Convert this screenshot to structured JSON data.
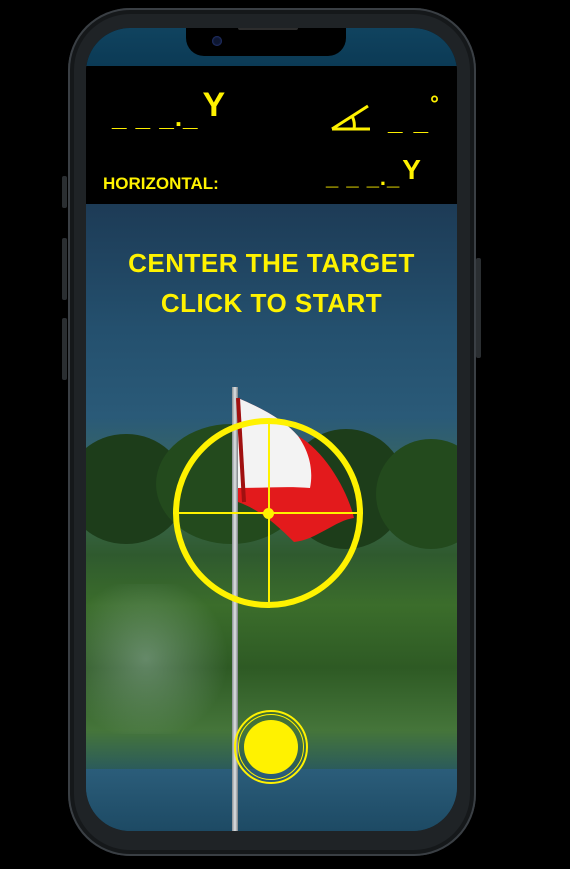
{
  "readout": {
    "distance_blanks": "_ _ _._",
    "distance_unit": "Y",
    "angle_blanks": "_ _",
    "angle_unit": "°",
    "horizontal_label": "HORIZONTAL:",
    "horizontal_blanks": "_ _ _._",
    "horizontal_unit": "Y"
  },
  "viewfinder": {
    "instruction_line1": "CENTER THE TARGET",
    "instruction_line2": "CLICK TO START"
  },
  "colors": {
    "accent": "#fff200",
    "background": "#000000"
  },
  "icons": {
    "angle": "angle-icon",
    "reticle": "crosshair-reticle",
    "shutter": "shutter-button"
  }
}
